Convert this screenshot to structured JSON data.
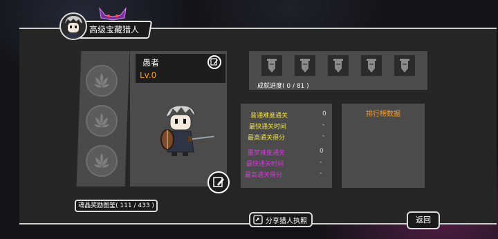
{
  "header": {
    "title": "高级宝藏猎人"
  },
  "hero": {
    "name": "愚者",
    "level": "Lv.0"
  },
  "achievements": {
    "progress_text": "成就进度( 0 / 81 )",
    "count_shown": 5
  },
  "stats": {
    "normal": [
      {
        "label": "普通难度通关",
        "value": "0"
      },
      {
        "label": "最快通关时间",
        "value": "-"
      },
      {
        "label": "最高通关得分",
        "value": "-"
      }
    ],
    "nightmare": [
      {
        "label": "噩梦难度通关",
        "value": "0"
      },
      {
        "label": "最快通关时间",
        "value": "-"
      },
      {
        "label": "最高通关得分",
        "value": "-"
      }
    ]
  },
  "ranking": {
    "title": "排行榜数据"
  },
  "bottom": {
    "crystal_label": "魂晶奖励图鉴( 111 / 433 )",
    "share_label": "分享猎人执照",
    "back_label": "返回"
  },
  "colors": {
    "accent": "#ff9a1a",
    "normal_label": "#f2e24a",
    "nightmare_label": "#d23ad8",
    "panel": "#4b4b4b"
  }
}
